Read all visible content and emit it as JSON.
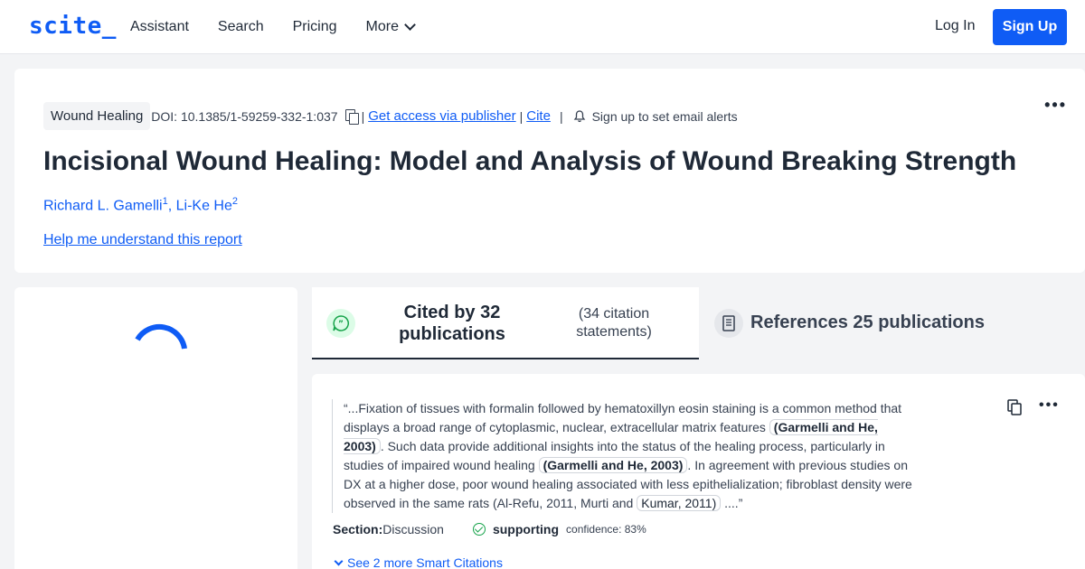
{
  "header": {
    "logo": "scite_",
    "nav": [
      "Assistant",
      "Search",
      "Pricing",
      "More"
    ],
    "login": "Log In",
    "signup": "Sign Up"
  },
  "paper": {
    "tag": "Wound Healing",
    "doi": "DOI: 10.1385/1-59259-332-1:037",
    "access_link": "Get access via publisher",
    "cite_link": "Cite",
    "alerts": "Sign up to set email alerts",
    "title": "Incisional Wound Healing: Model and Analysis of Wound Breaking Strength",
    "authors": [
      {
        "name": "Richard L. Gamelli",
        "sup": "1"
      },
      {
        "name": "Li-Ke He",
        "sup": "2"
      }
    ],
    "help_link": "Help me understand this report"
  },
  "tabs": {
    "cited_label": "Cited by 32 publications",
    "cited_sub": "(34 citation statements)",
    "refs_label": "References 25 publications"
  },
  "citation": {
    "text_1": "“...Fixation of tissues with formalin followed by hematoxillyn eosin staining is a common method that displays a broad range of cytoplasmic, nuclear, extracellular matrix features ",
    "ref_1": "(Garmelli and He, 2003)",
    "text_2": ". Such data provide additional insights into the status of the healing process, particularly in studies of impaired wound healing ",
    "ref_2": "(Garmelli and He, 2003)",
    "text_3": ". In agreement with previous studies on DX at a higher dose, poor wound healing associated with less epithelialization; fibroblast density were observed in the same rats (Al-Refu, 2011, Murti and ",
    "ref_3": "Kumar, 2011)",
    "text_4": " ....”",
    "section_label": "Section:",
    "section_value": " Discussion",
    "classification": "supporting",
    "confidence": "confidence: 83%",
    "more_link": "See 2 more Smart Citations"
  },
  "colors": {
    "brand": "#0f5cf5",
    "supporting": "#16a34a"
  }
}
